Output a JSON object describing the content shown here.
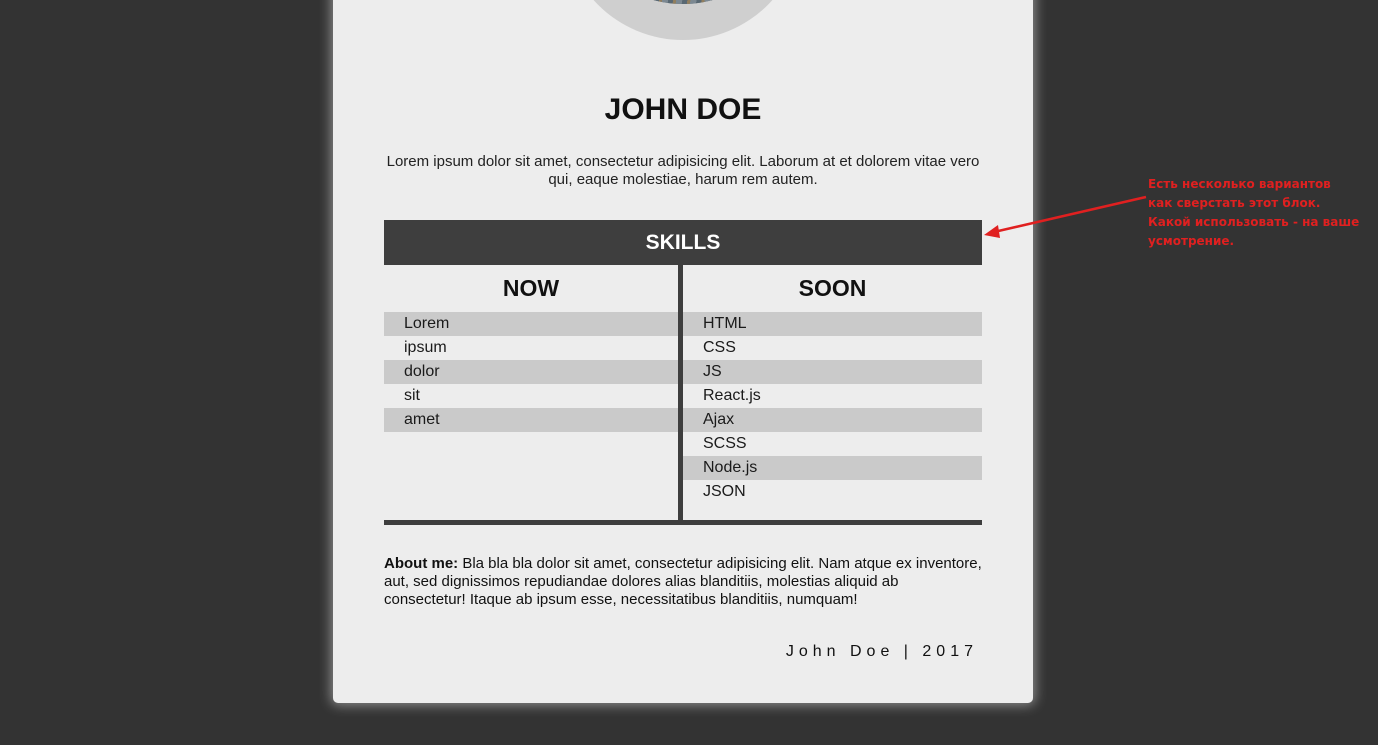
{
  "profile": {
    "name": "JOHN DOE",
    "intro": "Lorem ipsum dolor sit amet, consectetur adipisicing elit. Laborum at et dolorem vitae vero qui, eaque molestiae, harum rem autem."
  },
  "skills": {
    "title": "SKILLS",
    "now": {
      "title": "NOW",
      "items": [
        "Lorem",
        "ipsum",
        "dolor",
        "sit",
        "amet"
      ]
    },
    "soon": {
      "title": "SOON",
      "items": [
        "HTML",
        "CSS",
        "JS",
        "React.js",
        "Ajax",
        "SCSS",
        "Node.js",
        "JSON"
      ]
    }
  },
  "about": {
    "label": "About me:",
    "text": " Bla bla bla dolor sit amet, consectetur adipisicing elit. Nam atque ex inventore, aut, sed dignissimos repudiandae dolores alias blanditiis, molestias aliquid ab consectetur! Itaque ab ipsum esse, necessitatibus blanditiis, numquam!"
  },
  "footer": {
    "text": "John Doe | 2017"
  },
  "annotation": {
    "lines": [
      "Есть несколько вариантов",
      "как сверстать этот блок.",
      "Какой использовать - на ваше",
      "усмотрение."
    ],
    "color": "#e02020"
  },
  "colors": {
    "page_background": "#333333",
    "card_background": "#ededed",
    "skills_header": "#3e3e3e",
    "row_shade": "#cacaca"
  }
}
